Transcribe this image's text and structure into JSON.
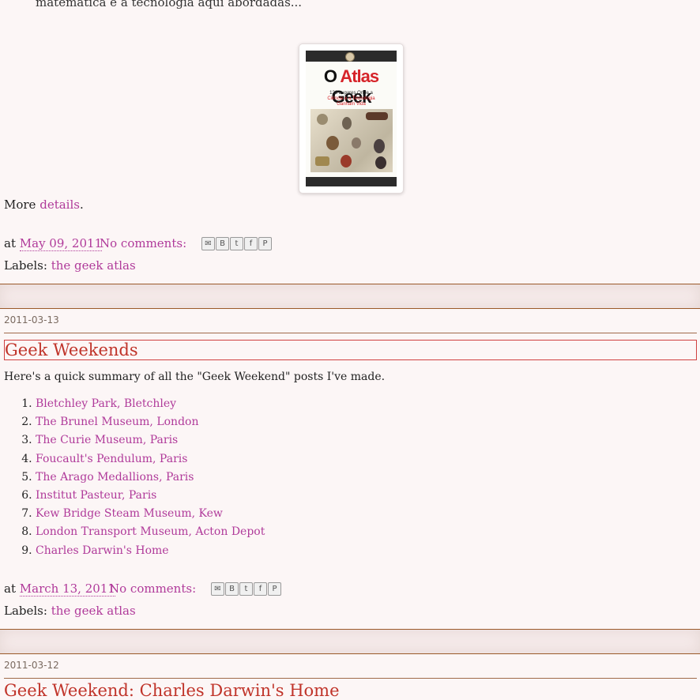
{
  "prev_post": {
    "cut_text": "matemática e a tecnologia aqui abordadas...",
    "book": {
      "title_o": "O ",
      "title_atlas": "Atlas",
      "title_geek": " Geek",
      "subtitle_line1": "128 Lugares Onde a",
      "subtitle_line2": "Ciência e a Tecnologia",
      "subtitle_line3": "Ganham Vida"
    },
    "more_prefix": "More ",
    "more_link": "details",
    "more_suffix": ".",
    "at": "at",
    "date_link": "May 09, 2011",
    "comments": "No comments:",
    "labels_prefix": "Labels:",
    "label": "the geek atlas"
  },
  "post1": {
    "date_header": "2011-03-13",
    "title": "Geek Weekends",
    "intro": "Here's a quick summary of all the \"Geek Weekend\" posts I've made.",
    "items": [
      "Bletchley Park, Bletchley",
      "The Brunel Museum, London",
      "The Curie Museum, Paris",
      "Foucault's Pendulum, Paris",
      "The Arago Medallions, Paris",
      "Institut Pasteur, Paris",
      "Kew Bridge Steam Museum, Kew",
      "London Transport Museum, Acton Depot",
      "Charles Darwin's Home"
    ],
    "at": "at",
    "date_link": "March 13, 2011",
    "comments": "No comments:",
    "labels_prefix": "Labels:",
    "label": "the geek atlas"
  },
  "post2": {
    "date_header": "2011-03-12",
    "title": "Geek Weekend: Charles Darwin's Home"
  },
  "share_icons": [
    "email-icon",
    "blogger-icon",
    "twitter-icon",
    "facebook-icon",
    "pinterest-icon"
  ],
  "colors": {
    "background": "#fcf6f6",
    "link": "#b03a9a",
    "title": "#c0342a",
    "separator": "#9b5a2a"
  }
}
